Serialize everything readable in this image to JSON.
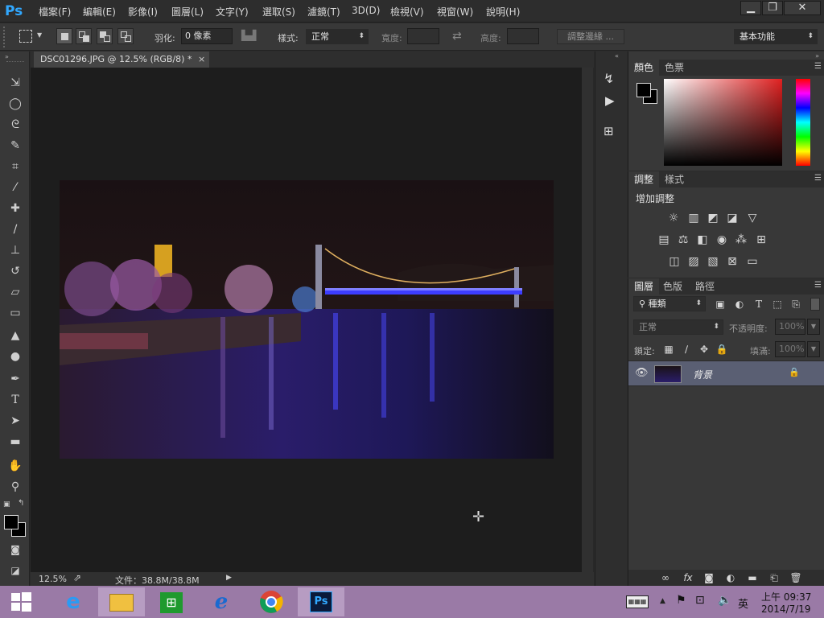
{
  "app": {
    "logo": "Ps"
  },
  "menu": [
    "檔案(F)",
    "編輯(E)",
    "影像(I)",
    "圖層(L)",
    "文字(Y)",
    "選取(S)",
    "濾鏡(T)",
    "3D(D)",
    "檢視(V)",
    "視窗(W)",
    "說明(H)"
  ],
  "window_controls": {
    "minimize": "▁",
    "restore": "❐",
    "close": "✕"
  },
  "options": {
    "feather_label": "羽化:",
    "feather_value": "0 像素",
    "style_label": "樣式:",
    "style_value": "正常",
    "width_label": "寬度:",
    "height_label": "高度:",
    "refine_edge": "調整邊緣 ...",
    "workspace": "基本功能"
  },
  "document": {
    "tab_title": "DSC01296.JPG @ 12.5% (RGB/8) *",
    "tab_close": "×",
    "zoom": "12.5%",
    "file_info": "文件：38.8M/38.8M"
  },
  "panels": {
    "color": {
      "tabs": [
        "顏色",
        "色票"
      ]
    },
    "adjustments": {
      "tabs": [
        "調整",
        "樣式"
      ],
      "heading": "增加調整"
    },
    "layers": {
      "tabs": [
        "圖層",
        "色版",
        "路徑"
      ],
      "filter_kind": "種類",
      "blend_mode": "正常",
      "opacity_label": "不透明度:",
      "opacity_value": "100%",
      "lock_label": "鎖定:",
      "fill_label": "填滿:",
      "fill_value": "100%",
      "layers": [
        {
          "name": "背景",
          "locked": true,
          "visible": true
        }
      ]
    }
  },
  "taskbar": {
    "apps": [
      "internet-explorer",
      "file-explorer",
      "store",
      "ie-update",
      "chrome",
      "photoshop"
    ],
    "language": "英",
    "time": "上午 09:37",
    "date": "2014/7/19"
  },
  "colors": {
    "accent": "#31a8ff",
    "taskbar": "#9a7aa6",
    "layer_selected": "#5a5f73"
  }
}
